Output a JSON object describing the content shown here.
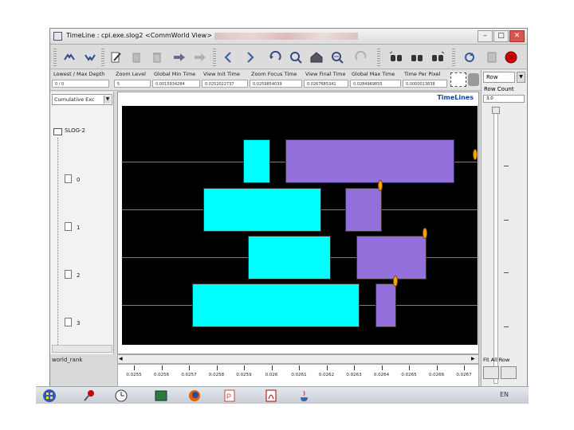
{
  "window": {
    "title": "TimeLine : cpi.exe.slog2 <CommWorld View>"
  },
  "toolbar": {
    "icons": [
      "zoom-out-icon",
      "zoom-in-icon",
      "edit-icon",
      "delete-icon",
      "trash-icon",
      "forward-icon",
      "forward-disabled-icon",
      "scroll-left-icon",
      "scroll-right-icon",
      "undo-icon",
      "zoom-search-icon",
      "home-icon",
      "zoom-search-out-icon",
      "redo-icon",
      "binoculars-left-icon",
      "binoculars-icon",
      "binoculars-right-icon",
      "refresh-icon",
      "print-icon",
      "stop-icon"
    ]
  },
  "fields": {
    "lowest_max_depth": {
      "label": "Lowest / Max Depth",
      "value": "0 / 0"
    },
    "zoom_level": {
      "label": "Zoom Level",
      "value": "5"
    },
    "global_min_time": {
      "label": "Global Min Time",
      "value": "0.0015934284"
    },
    "view_init_time": {
      "label": "View Init Time",
      "value": "0.0252022737"
    },
    "zoom_focus_time": {
      "label": "Zoom Focus Time",
      "value": "0.0259854039"
    },
    "view_final_time": {
      "label": "View Final Time",
      "value": "0.0267685341"
    },
    "global_max_time": {
      "label": "Global Max Time",
      "value": "0.0284969855"
    },
    "time_per_pixel": {
      "label": "Time Per Pixel",
      "value": "0.0000013838"
    }
  },
  "right": {
    "row_label": "Row",
    "row_count_label": "Row Count",
    "row_count_value": "3.0",
    "fit_all_label": "Fit All Row"
  },
  "left": {
    "combo_value": "Cumulative Exc",
    "root_label": "SLOG-2",
    "ranks": [
      "0",
      "1",
      "2",
      "3"
    ],
    "bottom_label": "world_rank"
  },
  "canvas": {
    "title": "TimeLines"
  },
  "ruler": {
    "ticks": [
      "0.0255",
      "0.0256",
      "0.0257",
      "0.0258",
      "0.0259",
      "0.026",
      "0.0261",
      "0.0262",
      "0.0263",
      "0.0264",
      "0.0265",
      "0.0266",
      "0.0267"
    ]
  },
  "taskbar": {
    "icons": [
      "start-icon",
      "pin-icon",
      "clock-icon",
      "image-viewer-icon",
      "firefox-icon",
      "powerpoint-icon",
      "pdf-icon",
      "java-icon"
    ],
    "language": "EN"
  },
  "colors": {
    "cyan_state": "#00ffff",
    "purple_state": "#9370db",
    "event_marker": "#ffa500",
    "timeline_bg": "#000000",
    "timeline_line": "#2aa0a0"
  }
}
